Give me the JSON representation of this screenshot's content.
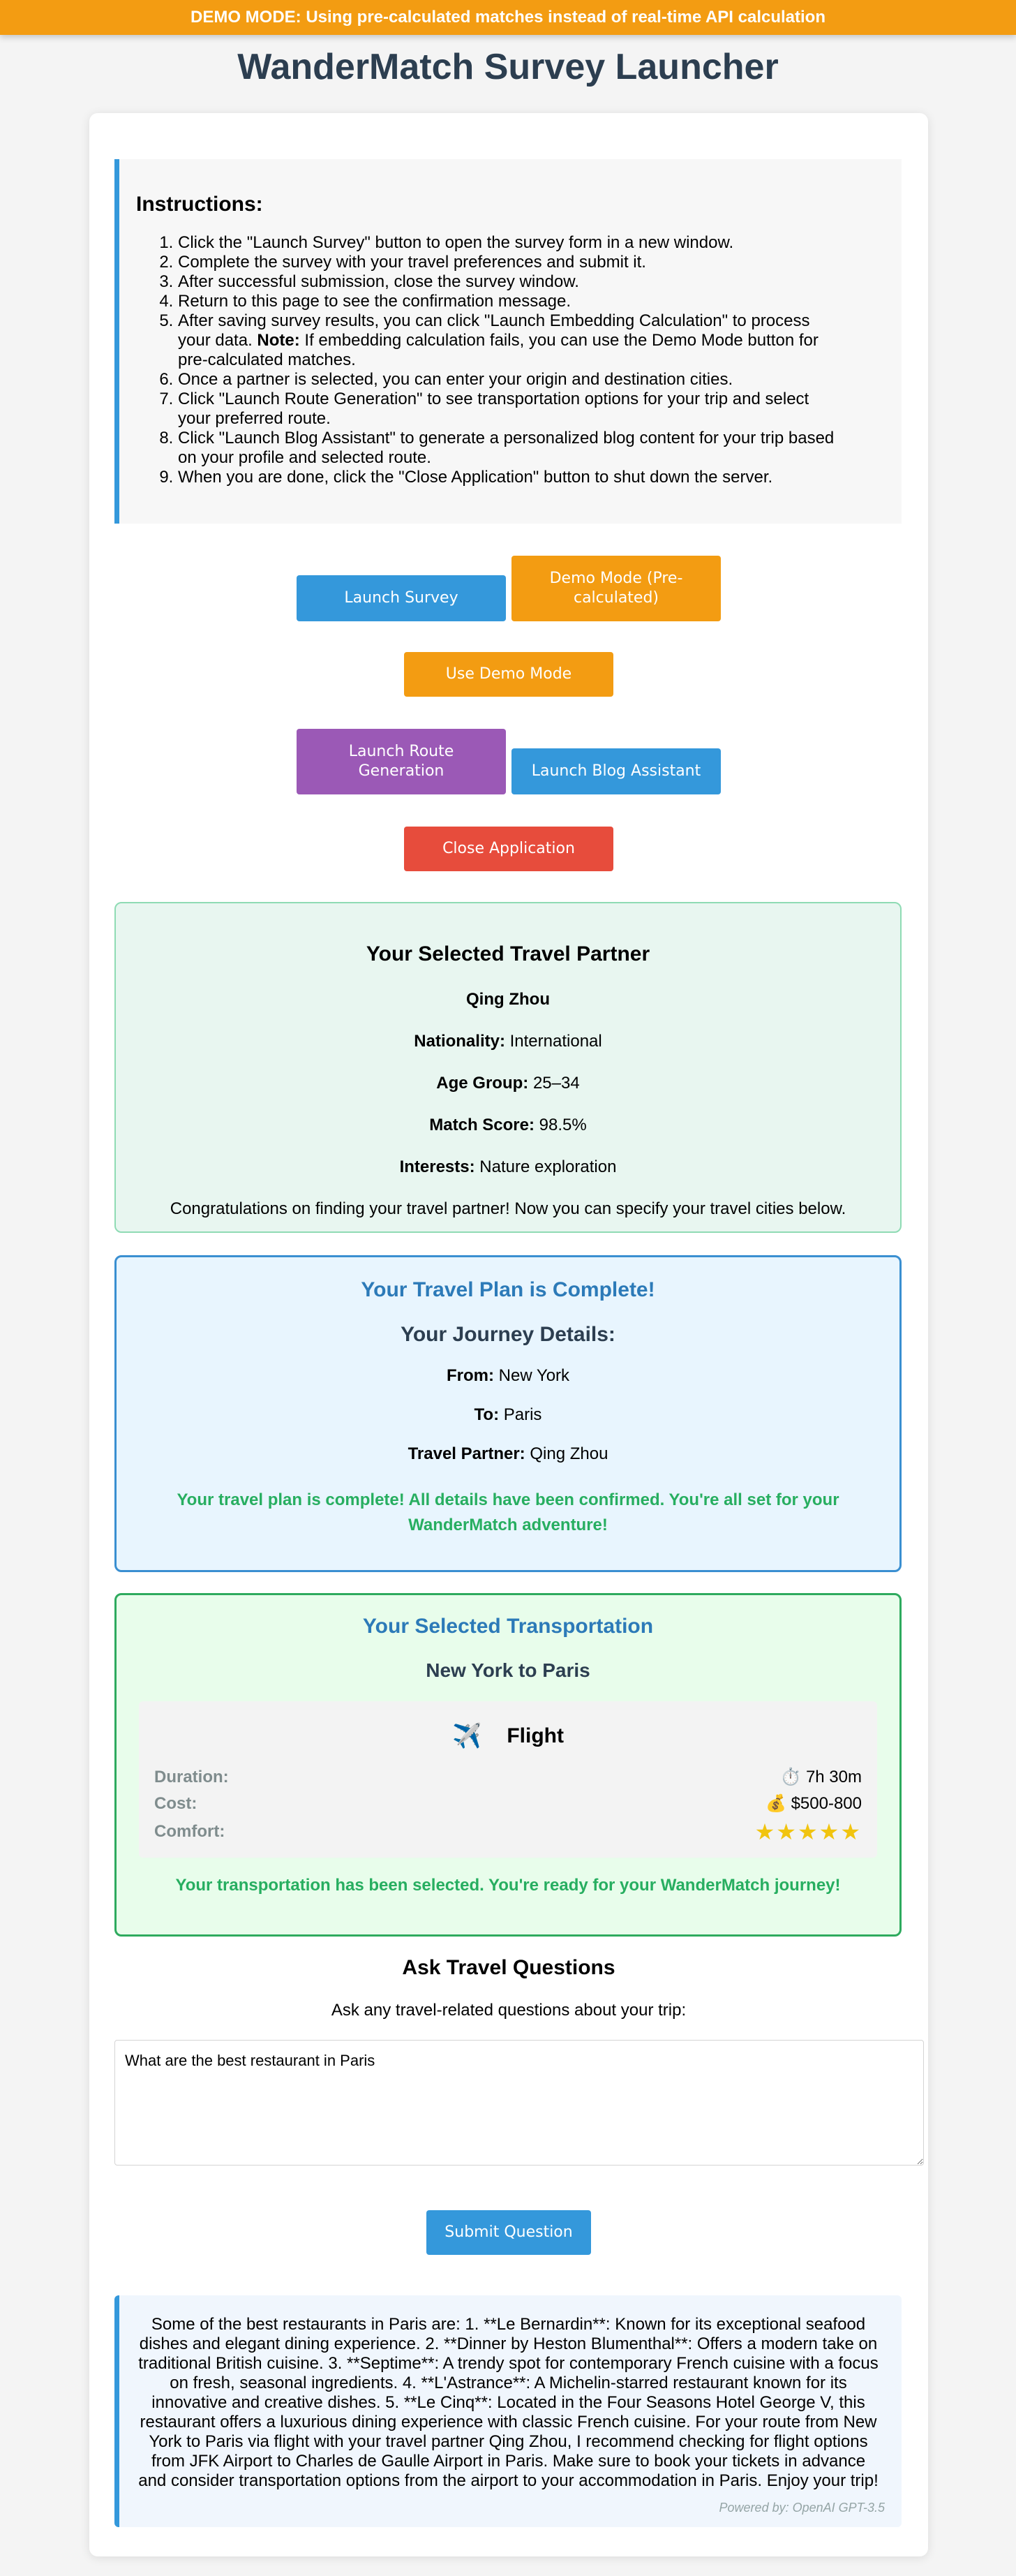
{
  "banner": "DEMO MODE: Using pre-calculated matches instead of real-time API calculation",
  "page_title": "WanderMatch Survey Launcher",
  "instructions": {
    "heading": "Instructions:",
    "steps": [
      "Click the \"Launch Survey\" button to open the survey form in a new window.",
      "Complete the survey with your travel preferences and submit it.",
      "After successful submission, close the survey window.",
      "Return to this page to see the confirmation message.",
      "After saving survey results, you can click \"Launch Embedding Calculation\" to process your data.",
      "Once a partner is selected, you can enter your origin and destination cities.",
      "Click \"Launch Route Generation\" to see transportation options for your trip and select your preferred route.",
      "Click \"Launch Blog Assistant\" to generate a personalized blog content for your trip based on your profile and selected route.",
      "When you are done, click the \"Close Application\" button to shut down the server."
    ],
    "step5_note_label": "Note:",
    "step5_note_text": "If embedding calculation fails, you can use the Demo Mode button for pre-calculated matches."
  },
  "buttons": {
    "launch_survey": "Launch Survey",
    "demo_mode_precalc": "Demo Mode (Pre-calculated)",
    "use_demo_mode": "Use Demo Mode",
    "launch_route": "Launch Route Generation",
    "launch_blog": "Launch Blog Assistant",
    "close_app": "Close Application",
    "submit_question": "Submit Question"
  },
  "partner": {
    "heading": "Your Selected Travel Partner",
    "name": "Qing Zhou",
    "nationality_label": "Nationality:",
    "nationality": "International",
    "age_label": "Age Group:",
    "age": "25–34",
    "score_label": "Match Score:",
    "score": "98.5%",
    "interests_label": "Interests:",
    "interests": "Nature exploration",
    "congrats": "Congratulations on finding your travel partner! Now you can specify your travel cities below."
  },
  "plan": {
    "heading": "Your Travel Plan is Complete!",
    "subheading": "Your Journey Details:",
    "from_label": "From:",
    "from": "New York",
    "to_label": "To:",
    "to": "Paris",
    "partner_label": "Travel Partner:",
    "partner": "Qing Zhou",
    "done": "Your travel plan is complete! All details have been confirmed. You're all set for your WanderMatch adventure!"
  },
  "transport": {
    "heading": "Your Selected Transportation",
    "route": "New York to Paris",
    "mode_icon": "✈️",
    "mode": "Flight",
    "duration_label": "Duration:",
    "duration_icon": "⏱️",
    "duration": "7h 30m",
    "cost_label": "Cost:",
    "cost_icon": "💰",
    "cost": "$500-800",
    "comfort_label": "Comfort:",
    "comfort_stars": "★★★★★",
    "comfort_rating": 5,
    "selected_msg": "Your transportation has been selected. You're ready for your WanderMatch journey!"
  },
  "ask": {
    "heading": "Ask Travel Questions",
    "subheading": "Ask any travel-related questions about your trip:",
    "question": "What are the best restaurant in Paris"
  },
  "answer": {
    "text": "Some of the best restaurants in Paris are: 1. **Le Bernardin**: Known for its exceptional seafood dishes and elegant dining experience. 2. **Dinner by Heston Blumenthal**: Offers a modern take on traditional British cuisine. 3. **Septime**: A trendy spot for contemporary French cuisine with a focus on fresh, seasonal ingredients. 4. **L'Astrance**: A Michelin-starred restaurant known for its innovative and creative dishes. 5. **Le Cinq**: Located in the Four Seasons Hotel George V, this restaurant offers a luxurious dining experience with classic French cuisine. For your route from New York to Paris via flight with your travel partner Qing Zhou, I recommend checking for flight options from JFK Airport to Charles de Gaulle Airport in Paris. Make sure to book your tickets in advance and consider transportation options from the airport to your accommodation in Paris. Enjoy your trip!",
    "powered_by": "Powered by: OpenAI GPT-3.5"
  },
  "colors": {
    "accent_blue": "#3498db",
    "demo_orange": "#f39c12",
    "route_purple": "#9b59b6",
    "close_red": "#e74c3c",
    "success_green": "#27ae60",
    "title_dark": "#2c3e50"
  }
}
